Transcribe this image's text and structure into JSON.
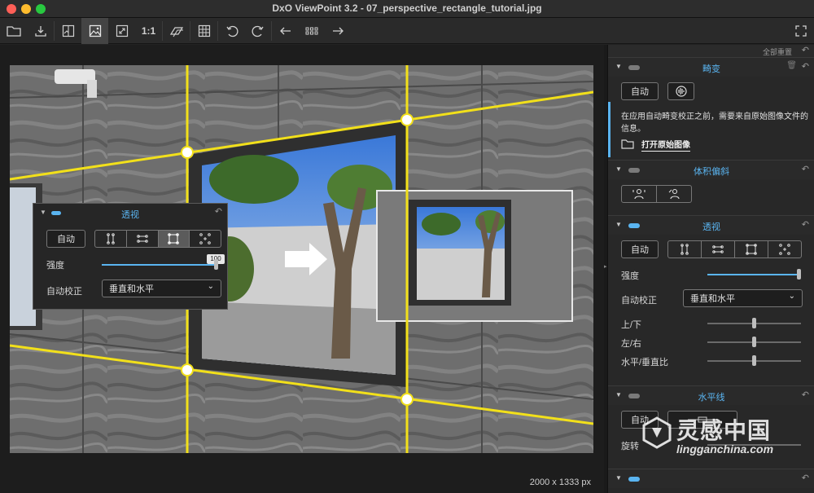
{
  "window": {
    "title": "DxO ViewPoint 3.2 - 07_perspective_rectangle_tutorial.jpg"
  },
  "toolbar": {
    "one_to_one_label": "1:1",
    "buttons": [
      "folder-icon",
      "export-icon",
      "compare-icon",
      "image-view-icon",
      "fit-screen-icon",
      "one-to-one",
      "before-after-icon",
      "grid-icon",
      "rotate-left-icon",
      "rotate-right-icon",
      "previous-icon",
      "thumbnails-icon",
      "next-icon",
      "fullscreen-icon"
    ]
  },
  "canvas": {
    "dimensions": "2000 x 1333 px"
  },
  "overlay_panel": {
    "title": "透视",
    "auto_label": "自动",
    "intensity_label": "强度",
    "intensity_value": "100",
    "auto_correct_label": "自动校正",
    "auto_correct_value": "垂直和水平",
    "selected_mode": 2
  },
  "right_panel": {
    "reset_all": "全部重置",
    "distortion": {
      "title": "畸变",
      "auto_label": "自动",
      "info_text_1": "在应用自动畸变校正之前，需要来自原始图像文件的",
      "info_text_2": "信息。",
      "open_original": "打开原始图像"
    },
    "volume": {
      "title": "体积偏斜"
    },
    "perspective": {
      "title": "透视",
      "auto_label": "自动",
      "intensity_label": "强度",
      "auto_correct_label": "自动校正",
      "auto_correct_value": "垂直和水平",
      "up_down_label": "上/下",
      "left_right_label": "左/右",
      "ratio_label": "水平/垂直比",
      "intensity_value": 1.0,
      "up_down_value": 0.5,
      "left_right_value": 0.5,
      "ratio_value": 0.5
    },
    "horizon": {
      "title": "水平线",
      "auto_label": "自动",
      "rotation_label": "旋转"
    }
  },
  "watermark": {
    "cn": "灵感中国",
    "en": "lingganchina.com"
  },
  "colors": {
    "accent": "#5ab4f0",
    "guide": "#f2e01a"
  }
}
